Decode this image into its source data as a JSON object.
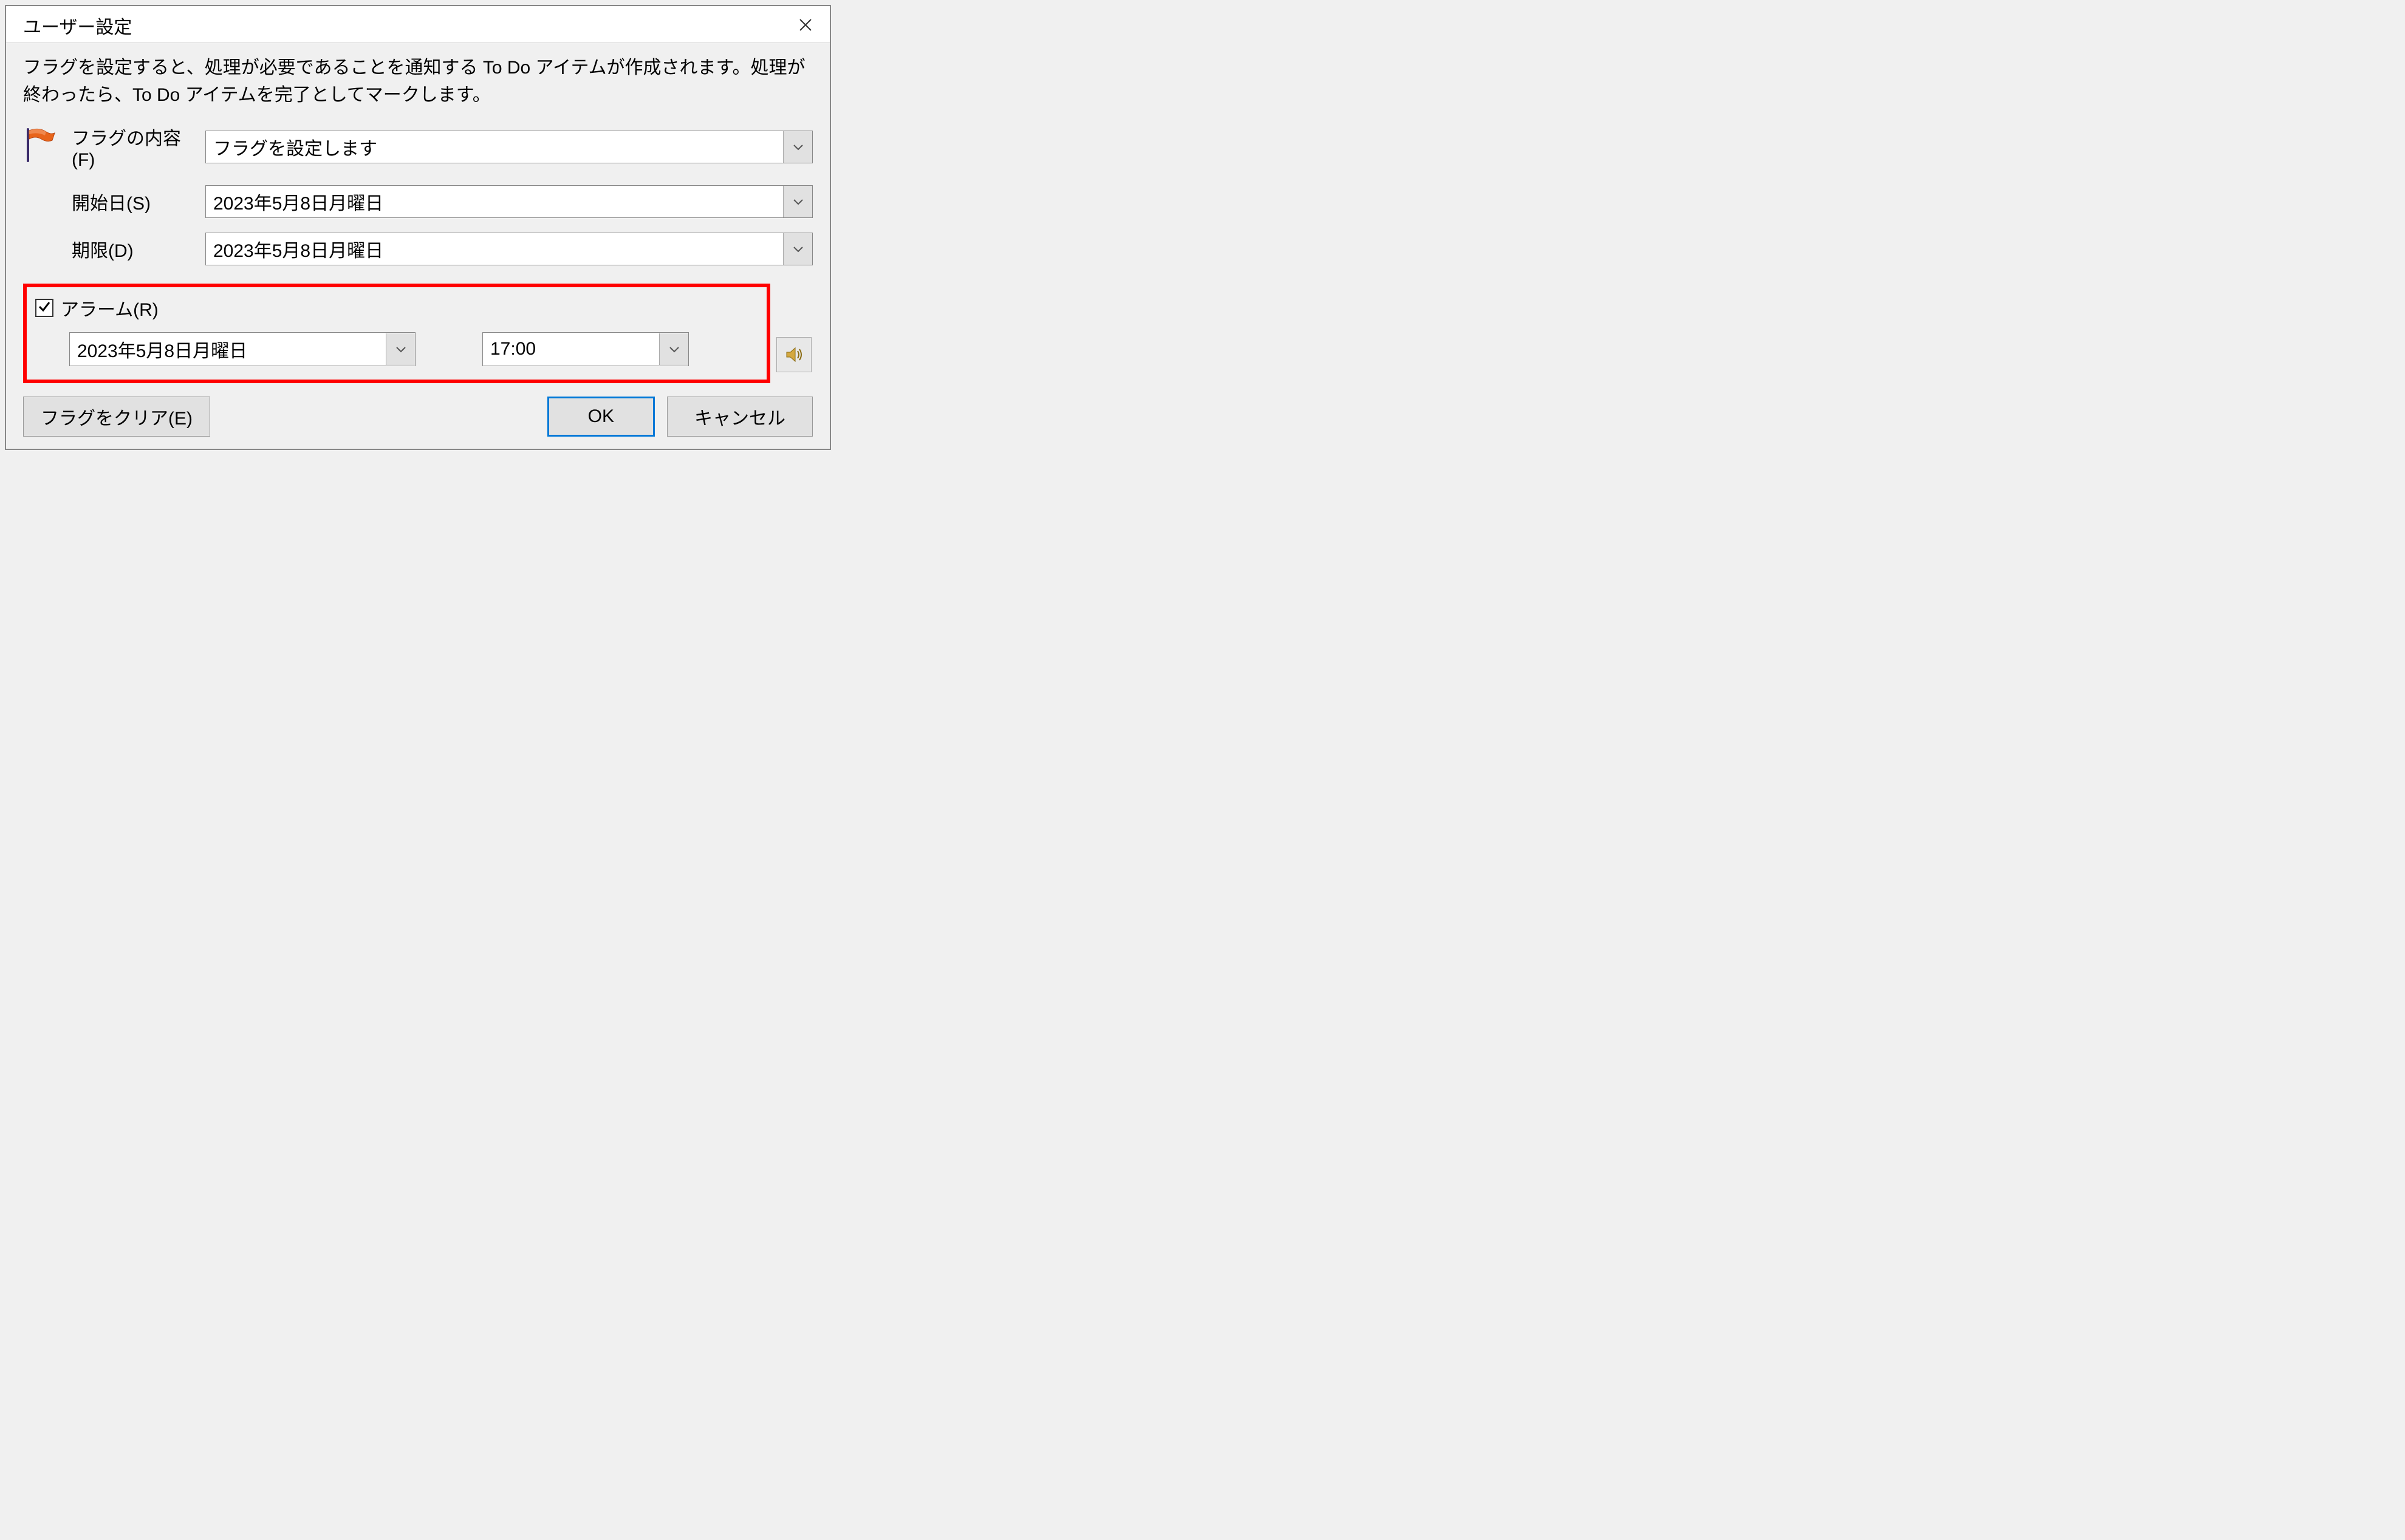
{
  "dialog": {
    "title": "ユーザー設定",
    "description": "フラグを設定すると、処理が必要であることを通知する To Do アイテムが作成されます。処理が終わったら、To Do アイテムを完了としてマークします。"
  },
  "fields": {
    "flag_content_label": "フラグの内容(F)",
    "flag_content_value": "フラグを設定します",
    "start_date_label": "開始日(S)",
    "start_date_value": "2023年5月8日月曜日",
    "due_date_label": "期限(D)",
    "due_date_value": "2023年5月8日月曜日"
  },
  "alarm": {
    "label": "アラーム(R)",
    "checked": true,
    "date_value": "2023年5月8日月曜日",
    "time_value": "17:00"
  },
  "buttons": {
    "clear_flag": "フラグをクリア(E)",
    "ok": "OK",
    "cancel": "キャンセル"
  }
}
